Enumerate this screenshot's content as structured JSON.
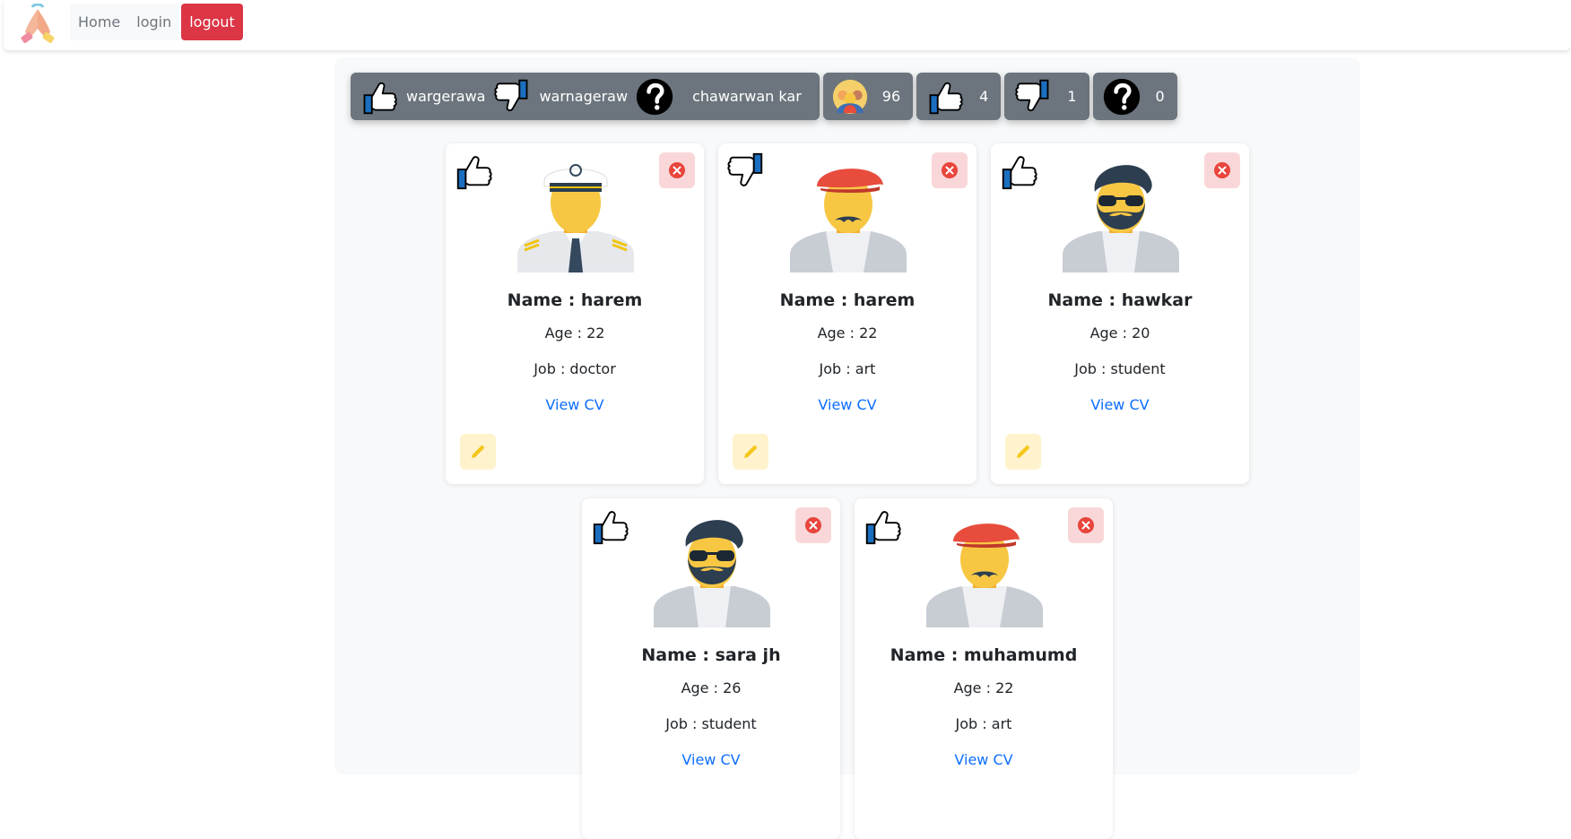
{
  "nav": {
    "home": "Home",
    "login": "login",
    "logout": "logout",
    "logo_icon": "praying-hands-icon"
  },
  "stats": {
    "like_label": "wargerawa",
    "dislike_label": "warnageraw",
    "unknown_label": "chawarwan kar",
    "total_count": "96",
    "like_count": "4",
    "dislike_count": "1",
    "unknown_count": "0"
  },
  "colors": {
    "logout": "#dc3545",
    "stat_bg": "#6c757d",
    "link": "#0d6efd",
    "delete_bg": "#f9d7d9",
    "edit_bg": "#fff3cd",
    "thumb_blue": "#1a6fc0"
  },
  "cards": [
    {
      "name": "Name : harem",
      "age": "Age : 22",
      "job": "Job : doctor",
      "cv": "View CV",
      "vote": "like",
      "avatar": "captain-avatar-icon"
    },
    {
      "name": "Name : harem",
      "age": "Age : 22",
      "job": "Job : art",
      "cv": "View CV",
      "vote": "dislike",
      "avatar": "beret-mustache-avatar-icon"
    },
    {
      "name": "Name : hawkar",
      "age": "Age : 20",
      "job": "Job : student",
      "cv": "View CV",
      "vote": "like",
      "avatar": "bearded-sunglasses-avatar-icon"
    },
    {
      "name": "Name : sara jh",
      "age": "Age : 26",
      "job": "Job : student",
      "cv": "View CV",
      "vote": "like",
      "avatar": "bearded-sunglasses-avatar-icon"
    },
    {
      "name": "Name : muhamumd",
      "age": "Age : 22",
      "job": "Job : art",
      "cv": "View CV",
      "vote": "like",
      "avatar": "beret-mustache-avatar-icon"
    }
  ]
}
